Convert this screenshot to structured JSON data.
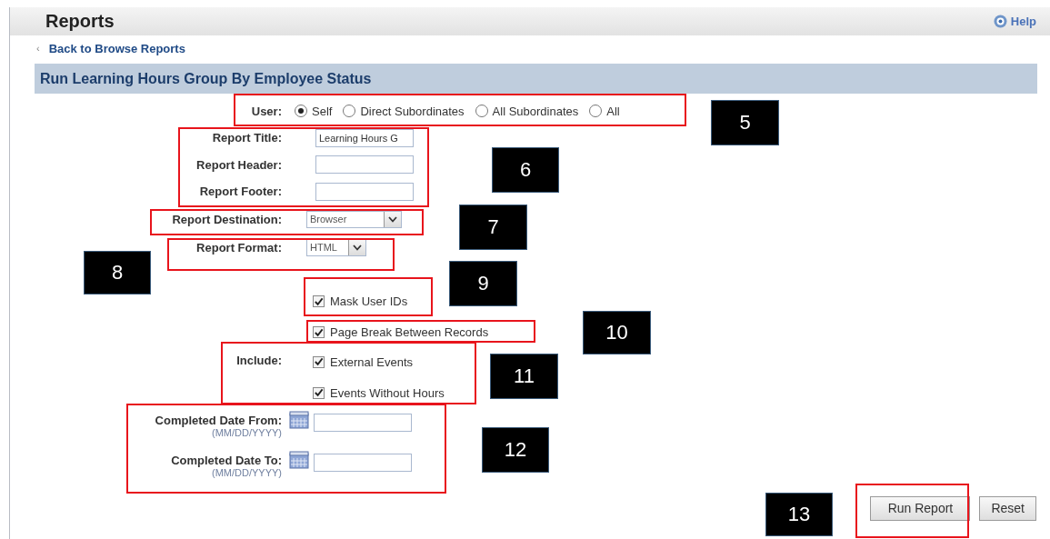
{
  "header": {
    "title": "Reports",
    "help": "Help"
  },
  "back_link": {
    "arrow": "‹",
    "label": "Back to Browse Reports"
  },
  "section_title": "Run Learning Hours Group By Employee Status",
  "user": {
    "label": "User:",
    "options": [
      {
        "label": "Self",
        "selected": true
      },
      {
        "label": "Direct Subordinates",
        "selected": false
      },
      {
        "label": "All Subordinates",
        "selected": false
      },
      {
        "label": "All",
        "selected": false
      }
    ]
  },
  "text_fields": [
    {
      "label": "Report Title:",
      "value": "Learning Hours G"
    },
    {
      "label": "Report Header:"
    },
    {
      "label": "Report Footer:"
    }
  ],
  "destination": {
    "label": "Report Destination:",
    "value": "Browser"
  },
  "format": {
    "label": "Report Format:",
    "value": "HTML"
  },
  "options": [
    {
      "label": "Mask User IDs",
      "checked": true
    },
    {
      "label": "Page Break Between Records",
      "checked": true
    }
  ],
  "include": {
    "label": "Include:",
    "items": [
      {
        "label": "External Events",
        "checked": true
      },
      {
        "label": "Events Without Hours",
        "checked": true
      }
    ]
  },
  "dates": [
    {
      "label": "Completed Date From:",
      "hint": "(MM/DD/YYYY)"
    },
    {
      "label": "Completed Date To:",
      "hint": "(MM/DD/YYYY)"
    }
  ],
  "buttons": [
    {
      "label": "Run Report"
    },
    {
      "label": "Reset"
    }
  ],
  "callouts": [
    {
      "label": "5"
    },
    {
      "label": "6"
    },
    {
      "label": "7"
    },
    {
      "label": "8"
    },
    {
      "label": "9"
    },
    {
      "label": "10"
    },
    {
      "label": "11"
    },
    {
      "label": "12"
    },
    {
      "label": "13"
    }
  ]
}
